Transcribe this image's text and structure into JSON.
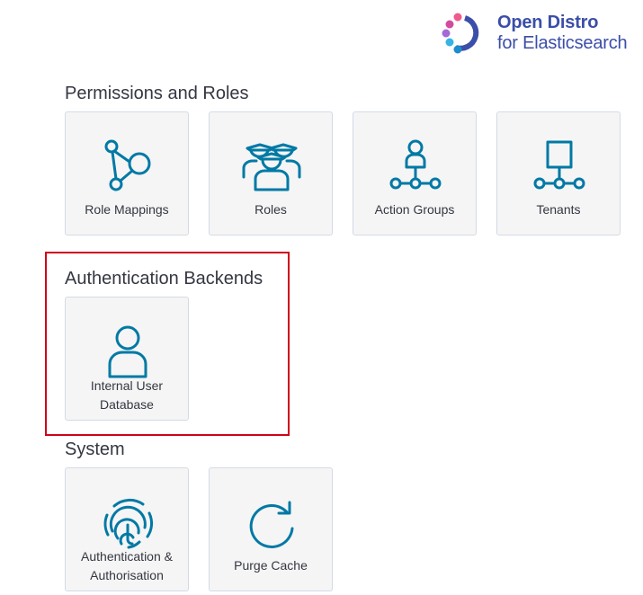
{
  "brand": {
    "name_line1": "Open Distro",
    "name_line2": "for Elasticsearch",
    "color": "#3b4ea8"
  },
  "accent_color": "#0079a5",
  "sections": {
    "permissions": {
      "title": "Permissions and Roles",
      "tiles": [
        {
          "label": "Role Mappings",
          "icon": "network-graph-icon"
        },
        {
          "label": "Roles",
          "icon": "users-group-icon"
        },
        {
          "label": "Action Groups",
          "icon": "person-hierarchy-icon"
        },
        {
          "label": "Tenants",
          "icon": "tenant-tree-icon"
        }
      ]
    },
    "auth_backends": {
      "title": "Authentication Backends",
      "tiles": [
        {
          "label": "Internal User Database",
          "icon": "user-icon"
        }
      ]
    },
    "system": {
      "title": "System",
      "tiles": [
        {
          "label": "Authentication & Authorisation",
          "icon": "fingerprint-icon"
        },
        {
          "label": "Purge Cache",
          "icon": "refresh-icon"
        }
      ]
    }
  },
  "highlight_color": "#d0021b"
}
